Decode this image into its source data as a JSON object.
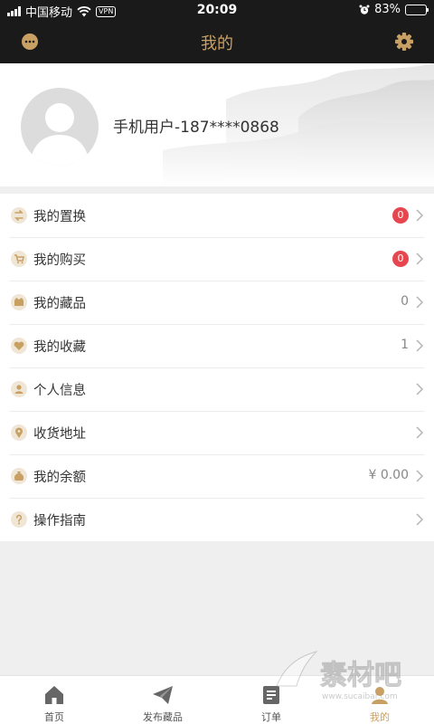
{
  "status_bar": {
    "carrier": "中国移动",
    "vpn": "VPN",
    "time": "20:09",
    "battery": "83%",
    "battery_level": 0.83
  },
  "header": {
    "title": "我的",
    "left_icon": "message-icon",
    "right_icon": "gear-icon"
  },
  "profile": {
    "username": "手机用户-187****0868"
  },
  "menu": [
    {
      "label": "我的置换",
      "icon": "exchange-icon",
      "badge": "0"
    },
    {
      "label": "我的购买",
      "icon": "cart-icon",
      "badge": "0"
    },
    {
      "label": "我的藏品",
      "icon": "collection-icon",
      "value": "0"
    },
    {
      "label": "我的收藏",
      "icon": "heart-icon",
      "value": "1"
    },
    {
      "label": "个人信息",
      "icon": "person-icon"
    },
    {
      "label": "收货地址",
      "icon": "location-icon"
    },
    {
      "label": "我的余额",
      "icon": "money-bag-icon",
      "value": "¥ 0.00"
    },
    {
      "label": "操作指南",
      "icon": "question-icon"
    }
  ],
  "tabs": [
    {
      "label": "首页",
      "icon": "home-icon"
    },
    {
      "label": "发布藏品",
      "icon": "paper-plane-icon"
    },
    {
      "label": "订单",
      "icon": "order-icon"
    },
    {
      "label": "我的",
      "icon": "user-icon",
      "active": true
    }
  ],
  "watermark": {
    "text": "素材吧",
    "subtext": "www.sucaibar.com"
  },
  "colors": {
    "accent": "#c9a064",
    "header_bg": "#1a1a1a",
    "badge": "#e6474f",
    "page_bg": "#efefef"
  }
}
